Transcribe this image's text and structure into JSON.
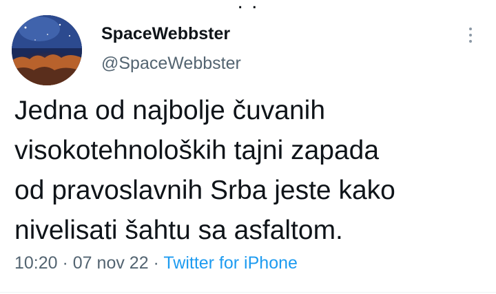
{
  "user": {
    "name": "SpaceWebbster",
    "handle": "@SpaceWebbster"
  },
  "tweet": {
    "lines": [
      "Jedna od najbolje čuvanih",
      "visokotehnoloških tajni zapada",
      "od pravoslavnih Srba jeste kako",
      "nivelisati šahtu sa asfaltom."
    ]
  },
  "meta": {
    "time": "10:20",
    "separator1": " · ",
    "date": "07 nov 22",
    "separator2": " · ",
    "source": "Twitter for iPhone"
  },
  "icons": {
    "more": "more-vertical-icon"
  },
  "colors": {
    "text": "#0f1419",
    "secondary": "#536471",
    "link": "#1d9bf0"
  }
}
